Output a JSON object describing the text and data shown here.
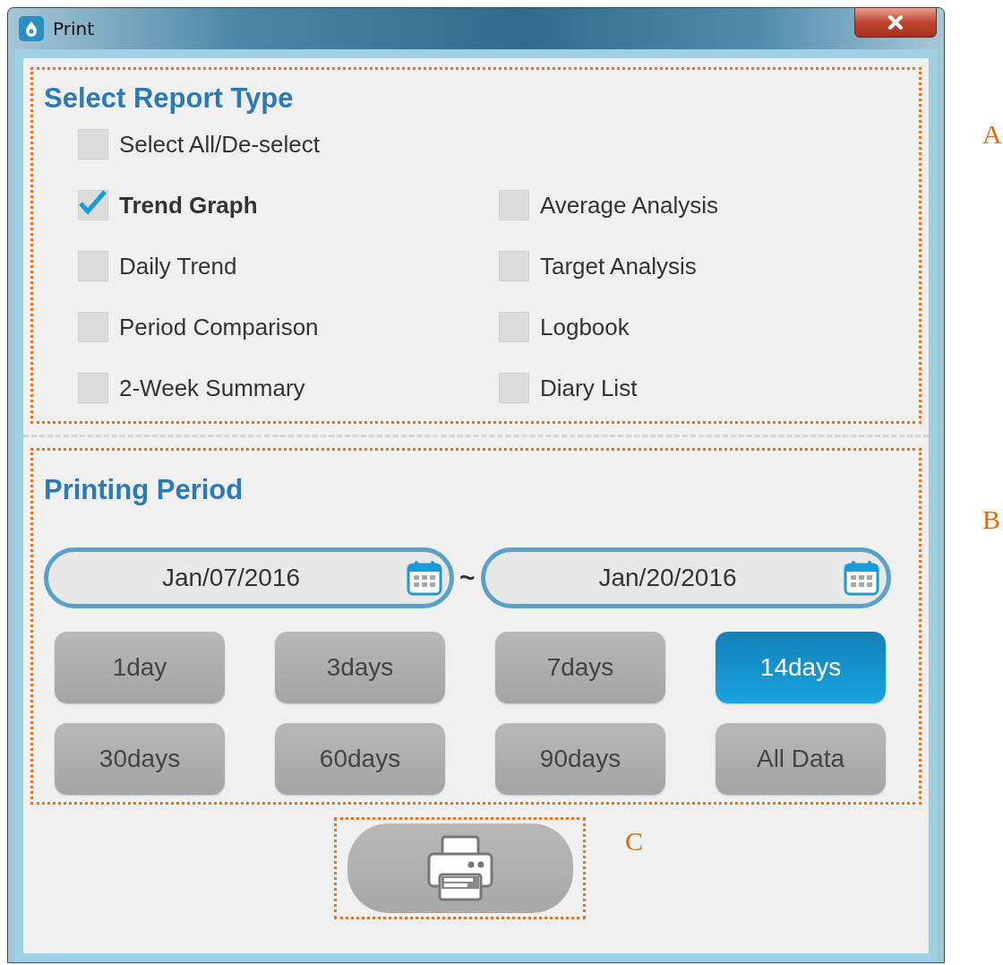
{
  "window": {
    "title": "Print"
  },
  "report_type": {
    "heading": "Select Report Type",
    "select_all": {
      "label": "Select All/De-select",
      "checked": false
    },
    "options": [
      {
        "label": "Trend Graph",
        "checked": true
      },
      {
        "label": "Average Analysis",
        "checked": false
      },
      {
        "label": "Daily Trend",
        "checked": false
      },
      {
        "label": "Target Analysis",
        "checked": false
      },
      {
        "label": "Period Comparison",
        "checked": false
      },
      {
        "label": "Logbook",
        "checked": false
      },
      {
        "label": "2-Week Summary",
        "checked": false
      },
      {
        "label": "Diary List",
        "checked": false
      }
    ]
  },
  "printing_period": {
    "heading": "Printing Period",
    "start_date": "Jan/07/2016",
    "separator": "~",
    "end_date": "Jan/20/2016",
    "ranges": [
      {
        "label": "1day",
        "selected": false
      },
      {
        "label": "3days",
        "selected": false
      },
      {
        "label": "7days",
        "selected": false
      },
      {
        "label": "14days",
        "selected": true
      },
      {
        "label": "30days",
        "selected": false
      },
      {
        "label": "60days",
        "selected": false
      },
      {
        "label": "90days",
        "selected": false
      },
      {
        "label": "All Data",
        "selected": false
      }
    ]
  },
  "annotations": [
    {
      "label": "A"
    },
    {
      "label": "B"
    },
    {
      "label": "C"
    }
  ]
}
